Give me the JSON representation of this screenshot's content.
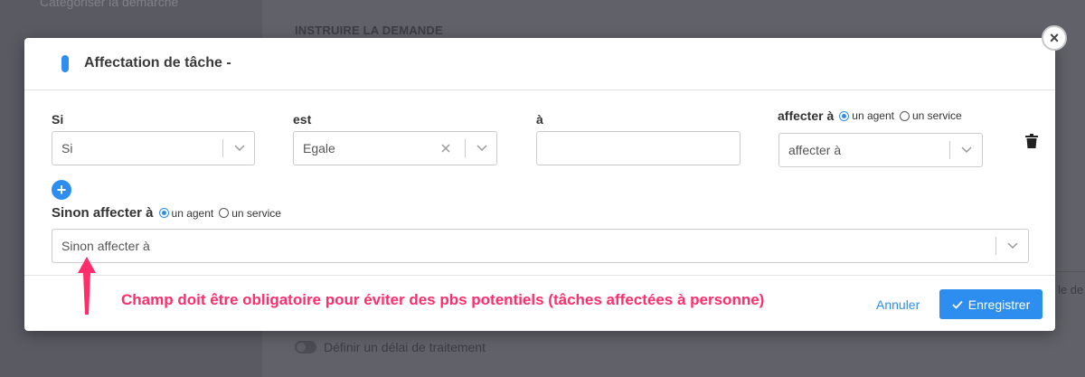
{
  "background": {
    "sidebar_link": "Catégoriser la démarche",
    "section_heading": "INSTRUIRE LA DEMANDE",
    "clipped_text": "le de",
    "toggle_label": "Définir un délai de traitement"
  },
  "modal": {
    "title": "Affectation de tâche -",
    "close_icon": "×",
    "condition": {
      "si_label": "Si",
      "si_select_value": "Si",
      "est_label": "est",
      "est_select_value": "Egale",
      "a_label": "à",
      "a_input_value": "",
      "affecter_label": "affecter à",
      "radio_agent": "un agent",
      "radio_service": "un service",
      "affecter_select_value": "affecter à"
    },
    "add_icon": "+",
    "sinon": {
      "label": "Sinon affecter à",
      "radio_agent": "un agent",
      "radio_service": "un service",
      "select_placeholder": "Sinon affecter à"
    },
    "annotation": "Champ doit être obligatoire pour éviter des pbs potentiels (tâches affectées à personne)",
    "footer": {
      "cancel_label": "Annuler",
      "save_label": "Enregistrer"
    }
  },
  "colors": {
    "accent": "#2d8ef0",
    "annotation": "#ff2d6a"
  }
}
